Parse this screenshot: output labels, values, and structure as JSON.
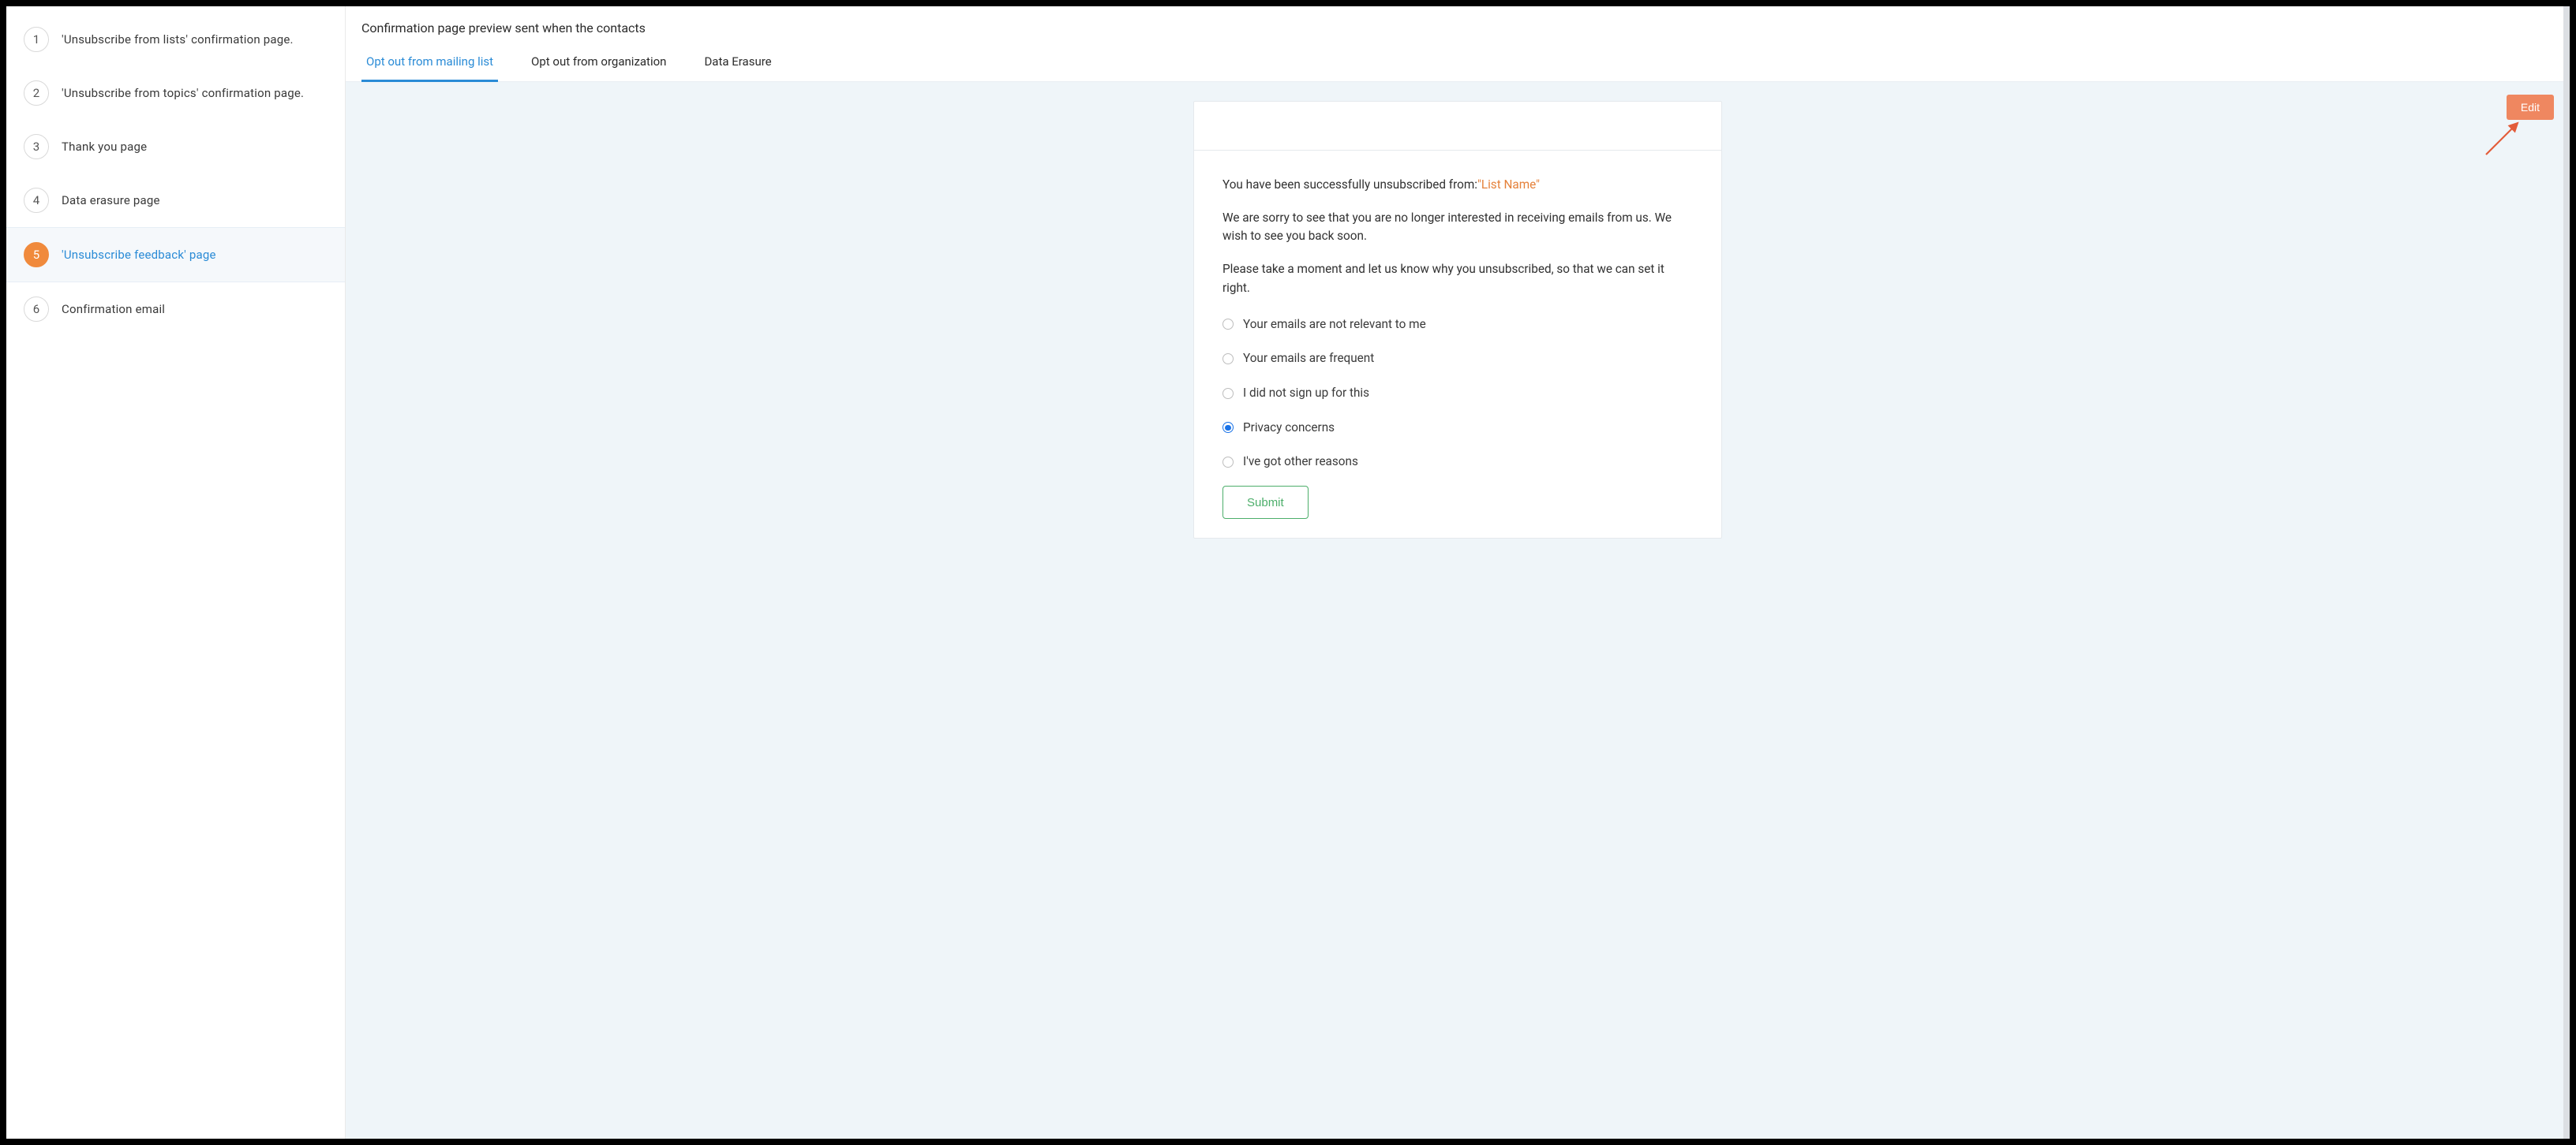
{
  "sidebar": {
    "items": [
      {
        "num": "1",
        "label": "'Unsubscribe from lists' confirmation page."
      },
      {
        "num": "2",
        "label": "'Unsubscribe from topics' confirmation page."
      },
      {
        "num": "3",
        "label": "Thank you page"
      },
      {
        "num": "4",
        "label": "Data erasure page"
      },
      {
        "num": "5",
        "label": "'Unsubscribe feedback' page"
      },
      {
        "num": "6",
        "label": "Confirmation email"
      }
    ],
    "active_index": 4
  },
  "header": {
    "title": "Confirmation page preview sent when the contacts"
  },
  "tabs": {
    "items": [
      {
        "label": "Opt out from mailing list"
      },
      {
        "label": "Opt out from organization"
      },
      {
        "label": "Data Erasure"
      }
    ],
    "active_index": 0
  },
  "preview": {
    "line1_prefix": "You have been successfully unsubscribed from:",
    "list_name": "\"List Name\"",
    "line2": "We are sorry to see that you are no longer interested in receiving emails from us. We wish to see you back soon.",
    "line3": "Please take a moment and let us know why you unsubscribed, so that we can set it right.",
    "options": [
      "Your emails are not relevant to me",
      "Your emails are frequent",
      "I did not sign up for this",
      "Privacy concerns",
      "I've got other reasons"
    ],
    "selected_option_index": 3,
    "submit_label": "Submit"
  },
  "actions": {
    "edit_label": "Edit"
  }
}
